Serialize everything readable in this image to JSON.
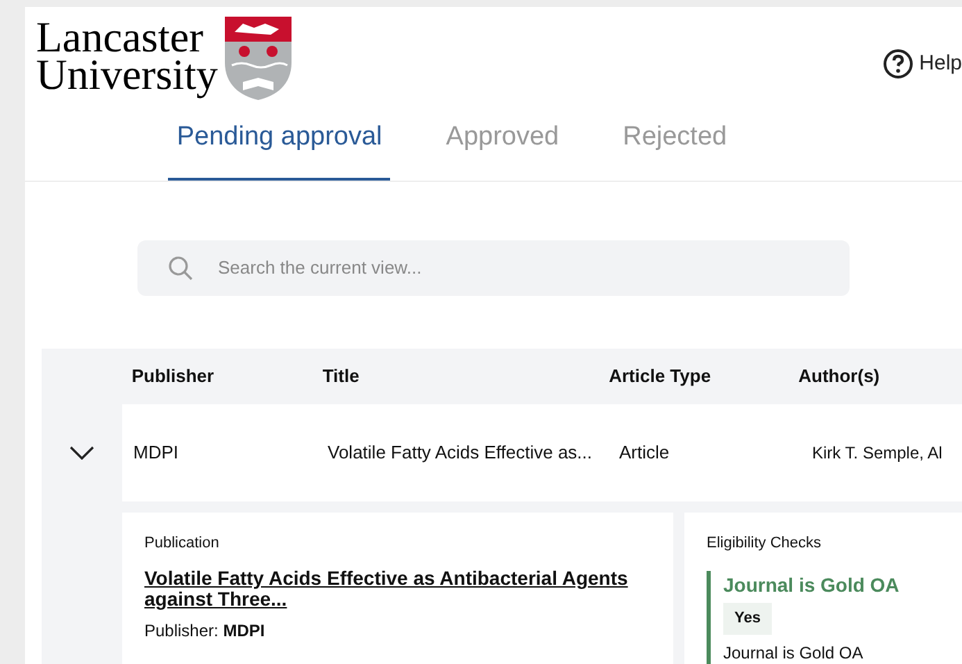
{
  "logo": {
    "line_1": "Lancaster",
    "line_2": "University"
  },
  "help": {
    "label": "Help"
  },
  "tabs": [
    {
      "label": "Pending approval",
      "selected": true
    },
    {
      "label": "Approved",
      "selected": false
    },
    {
      "label": "Rejected",
      "selected": false
    }
  ],
  "search": {
    "placeholder": "Search the current view..."
  },
  "table": {
    "columns": [
      "Publisher",
      "Title",
      "Article Type",
      "Author(s)"
    ],
    "rows": [
      {
        "expanded": true,
        "cells": [
          "MDPI",
          "Volatile Fatty Acids Effective as...",
          "Article",
          "Kirk T. Semple, Al"
        ]
      }
    ]
  },
  "publication": {
    "heading": "Publication",
    "title": "Volatile Fatty Acids Effective as Antibacterial Agents against Three...",
    "publisher_label": "Publisher:",
    "publisher": "MDPI"
  },
  "eligibility": {
    "heading": "Eligibility Checks",
    "checks": [
      {
        "title": "Journal is Gold OA",
        "passed": true,
        "answer": "Yes",
        "detail": "Journal is Gold OA"
      }
    ]
  }
}
